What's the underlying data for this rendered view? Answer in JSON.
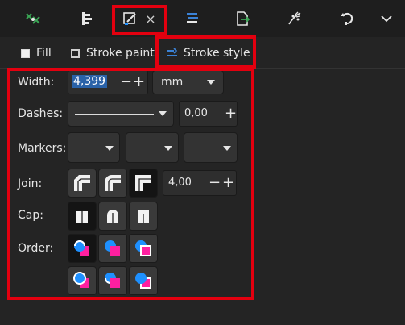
{
  "toolbar": {
    "buttons": [
      {
        "name": "align-icon"
      },
      {
        "name": "distribute-icon"
      },
      {
        "name": "fill-stroke-icon"
      },
      {
        "name": "layers-icon"
      },
      {
        "name": "export-icon"
      },
      {
        "name": "path-effects-icon"
      },
      {
        "name": "undo-history-icon"
      },
      {
        "name": "more-chevron-icon"
      }
    ],
    "active_close_glyph": "×"
  },
  "tabs": [
    {
      "label": "Fill"
    },
    {
      "label": "Stroke paint"
    },
    {
      "label": "Stroke style"
    }
  ],
  "stroke_style": {
    "width_label": "Width:",
    "width_value": "4,399",
    "unit_value": "mm",
    "dashes_label": "Dashes:",
    "dash_offset": "0,00",
    "markers_label": "Markers:",
    "join_label": "Join:",
    "miter_limit": "4,00",
    "cap_label": "Cap:",
    "order_label": "Order:",
    "minus": "−",
    "plus": "+"
  },
  "colors": {
    "highlight_red": "#e3000f",
    "accent_blue": "#3b82d6",
    "order_fill_blue": "#1e90ff",
    "order_marker_pink": "#ff1fa0",
    "order_stroke_white": "#ffffff"
  }
}
